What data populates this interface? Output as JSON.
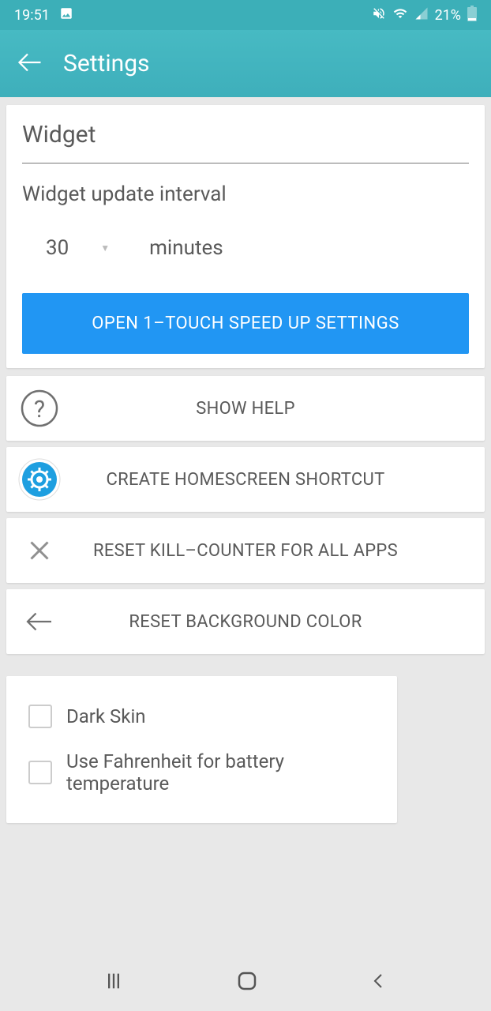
{
  "status": {
    "time": "19:51",
    "battery": "21%"
  },
  "appBar": {
    "title": "Settings"
  },
  "widget": {
    "sectionTitle": "Widget",
    "intervalLabel": "Widget update interval",
    "intervalValue": "30",
    "intervalUnit": "minutes",
    "speedUpButton": "OPEN 1–TOUCH SPEED UP SETTINGS"
  },
  "actions": {
    "showHelp": "SHOW HELP",
    "createShortcut": "CREATE HOMESCREEN SHORTCUT",
    "resetKillCounter": "RESET KILL–COUNTER FOR ALL APPS",
    "resetBgColor": "RESET BACKGROUND COLOR"
  },
  "checkboxes": {
    "darkSkin": "Dark Skin",
    "fahrenheit": "Use Fahrenheit for battery temperature"
  }
}
